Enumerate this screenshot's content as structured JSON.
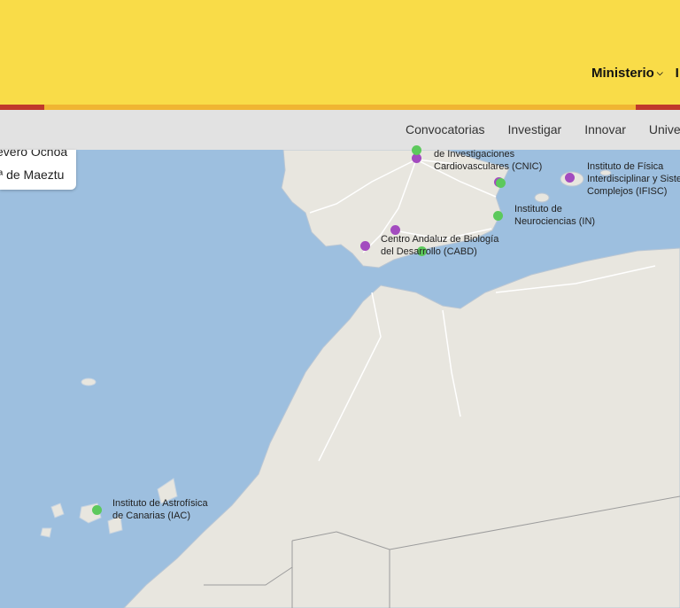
{
  "header": {
    "nav": [
      {
        "label": "Ministerio",
        "has_dropdown": true
      },
      {
        "label": "I",
        "has_dropdown": false
      }
    ]
  },
  "subnav": {
    "items": [
      "Convocatorias",
      "Investigar",
      "Innovar",
      "Univer"
    ]
  },
  "legend": {
    "line1": "evero Ochoa",
    "line2": "ª de Maeztu"
  },
  "map": {
    "colors": {
      "sea": "#9dbfdf",
      "land": "#e8e6df",
      "purple": "#a34bbf",
      "green": "#5cc95c"
    },
    "centers": [
      {
        "name_lines": [
          "de Investigaciones",
          "Cardiovasculares (CNIC)"
        ],
        "type": "purple"
      },
      {
        "name_lines": [
          "Instituto de Física",
          "Interdisciplinar y Siste",
          "Complejos (IFISC)"
        ],
        "type": "purple"
      },
      {
        "name_lines": [
          "Instituto de",
          "Neurociencias (IN)"
        ],
        "type": "green"
      },
      {
        "name_lines": [
          "Centro Andaluz de Biología",
          "del Desarrollo (CABD)"
        ],
        "type": "green"
      },
      {
        "name_lines": [
          "Instituto de Astrofísica",
          "de Canarias (IAC)"
        ],
        "type": "green"
      }
    ]
  }
}
